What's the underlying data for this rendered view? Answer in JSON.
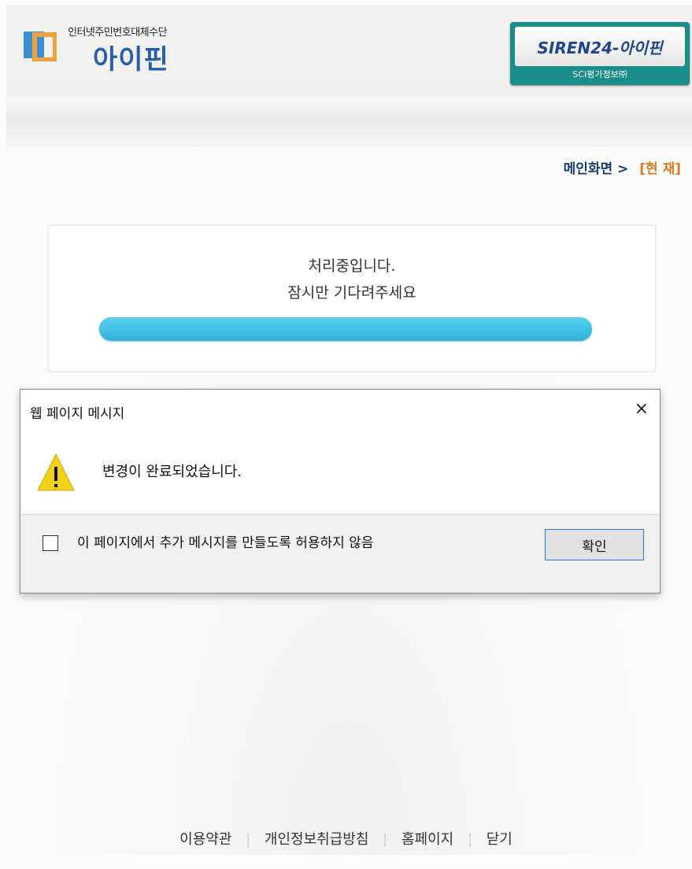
{
  "header": {
    "logo_tag": "인터넷주민번호대체수단",
    "logo_text": "아이핀",
    "siren_brand": "SIREN24-아이핀",
    "siren_sub": "SCI평가정보㈜"
  },
  "breadcrumb": {
    "home": "메인화면 >",
    "current": "[현 재]"
  },
  "processing": {
    "line1": "처리중입니다.",
    "line2": "잠시만 기다려주세요",
    "progress": 1.0
  },
  "dialog": {
    "title": "웹 페이지 메시지",
    "close_label": "×",
    "message": "변경이 완료되었습니다.",
    "checkbox_label": "이 페이지에서 추가 메시지를 만들도록 허용하지 않음",
    "ok_label": "확인",
    "warning_icon": "warning-triangle-icon"
  },
  "footer": {
    "links": [
      "이용약관",
      "개인정보취급방침",
      "홈페이지",
      "닫기"
    ],
    "separator": "|"
  }
}
